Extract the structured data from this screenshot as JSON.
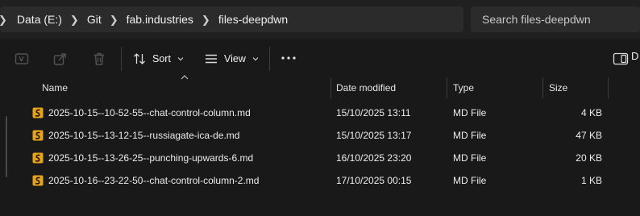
{
  "breadcrumbs": [
    "Data (E:)",
    "Git",
    "fab.industries",
    "files-deepdwn"
  ],
  "search": {
    "placeholder": "Search files-deepdwn"
  },
  "toolbar": {
    "sort_label": "Sort",
    "view_label": "View",
    "details_label": "D"
  },
  "columns": {
    "name": "Name",
    "date": "Date modified",
    "type": "Type",
    "size": "Size"
  },
  "files": [
    {
      "name": "2025-10-15--10-52-55--chat-control-column.md",
      "date": "15/10/2025 13:11",
      "type": "MD File",
      "size": "4 KB"
    },
    {
      "name": "2025-10-15--13-12-15--russiagate-ica-de.md",
      "date": "15/10/2025 13:17",
      "type": "MD File",
      "size": "47 KB"
    },
    {
      "name": "2025-10-15--13-26-25--punching-upwards-6.md",
      "date": "16/10/2025 23:20",
      "type": "MD File",
      "size": "20 KB"
    },
    {
      "name": "2025-10-16--23-22-50--chat-control-column-2.md",
      "date": "17/10/2025 00:15",
      "type": "MD File",
      "size": "1 KB"
    }
  ],
  "colors": {
    "background": "#191919",
    "addressbar": "#2b2b2b",
    "file_icon": "#e8a21a",
    "text": "#ececec"
  },
  "icons": [
    "chevron-right-icon",
    "rename-icon",
    "share-icon",
    "delete-icon",
    "sort-icon",
    "view-icon",
    "more-icon",
    "details-pane-icon",
    "markdown-file-icon"
  ]
}
